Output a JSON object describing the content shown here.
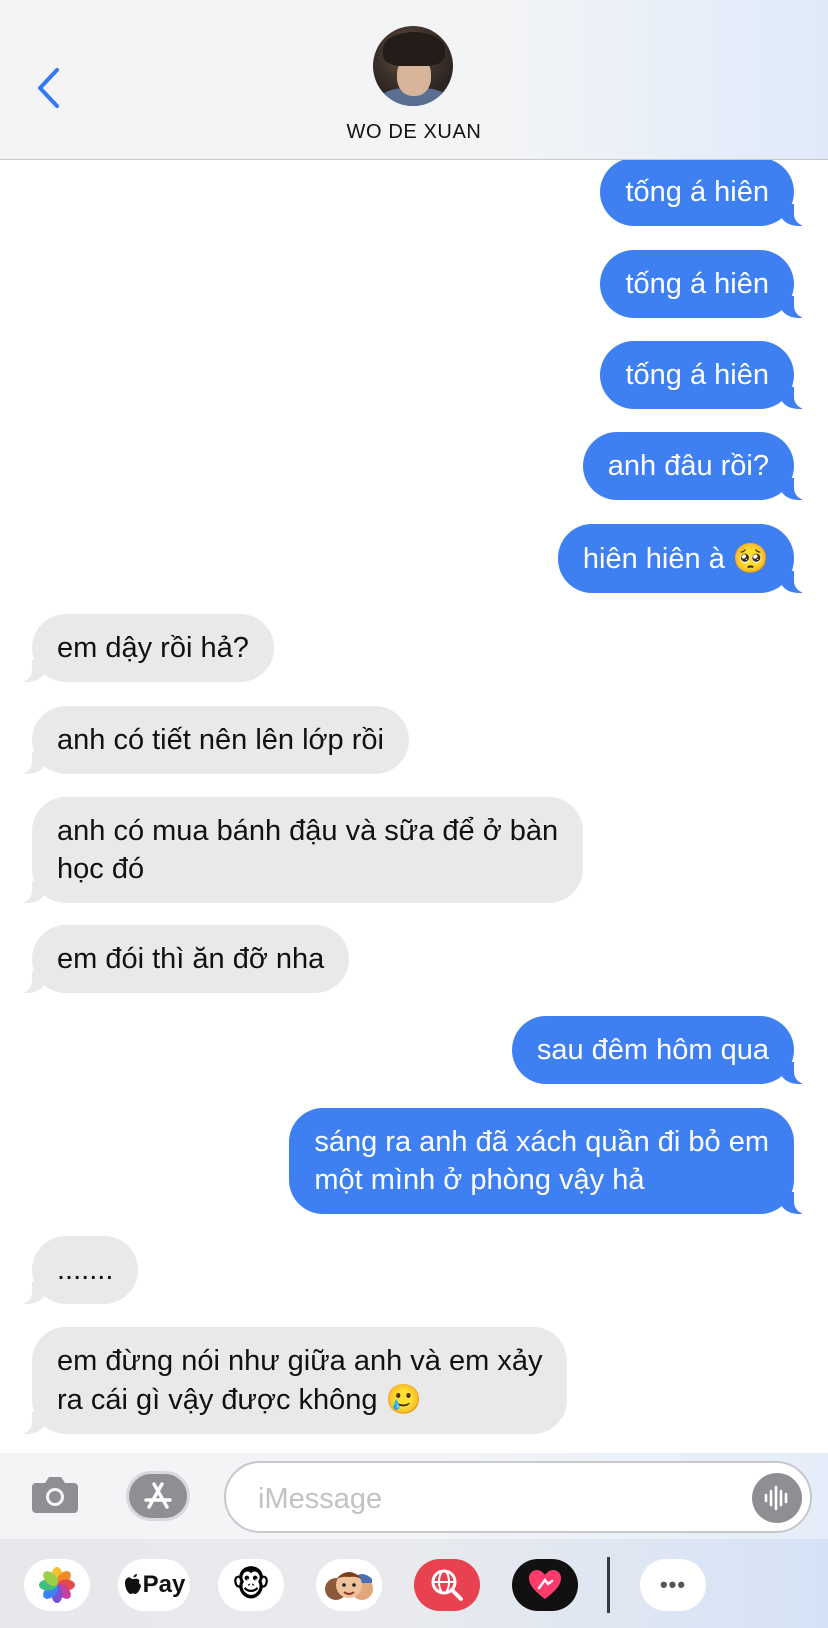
{
  "header": {
    "contact_name": "WO DE XUAN",
    "back_icon": "chevron-left-icon",
    "accent_color": "#3478F6"
  },
  "messages": [
    {
      "dir": "out",
      "text": "tống á hiên"
    },
    {
      "dir": "out",
      "text": "tống á hiên"
    },
    {
      "dir": "out",
      "text": "tống á hiên"
    },
    {
      "dir": "out",
      "text": "anh đâu rồi?"
    },
    {
      "dir": "out",
      "text": "hiên hiên à",
      "emoji": "🥺"
    },
    {
      "dir": "in",
      "text": "em dậy rồi hả?"
    },
    {
      "dir": "in",
      "text": "anh có tiết nên lên lớp rồi"
    },
    {
      "dir": "in",
      "text": "anh có mua bánh đậu và sữa để ở bàn",
      "text2": "học đó"
    },
    {
      "dir": "in",
      "text": "em đói thì ăn đỡ nha"
    },
    {
      "dir": "out",
      "text": "sau đêm hôm qua"
    },
    {
      "dir": "out",
      "text": "sáng ra anh đã xách quần đi bỏ em",
      "text2": "một mình ở phòng vậy hả"
    },
    {
      "dir": "in",
      "text": "......."
    },
    {
      "dir": "in",
      "text": "em đừng nói như giữa anh và em xảy",
      "text2": "ra cái gì vậy được không",
      "emoji": "🥲"
    }
  ],
  "composer": {
    "placeholder": "iMessage",
    "camera_icon": "camera-icon",
    "apps_icon": "app-store-icon",
    "mic_icon": "audio-waveform-icon"
  },
  "app_drawer": {
    "items": [
      {
        "name": "photos-app",
        "icon": "photos-icon"
      },
      {
        "name": "apple-pay-app",
        "label": "Pay",
        "icon": "apple-icon"
      },
      {
        "name": "animoji-app",
        "icon": "monkey-icon",
        "emoji": "🐵"
      },
      {
        "name": "memoji-app",
        "icon": "memoji-icon"
      },
      {
        "name": "web-search-app",
        "icon": "globe-search-icon"
      },
      {
        "name": "digital-touch-app",
        "icon": "heart-touch-icon"
      },
      {
        "name": "more-apps",
        "label": "•••",
        "icon": "more-icon"
      }
    ]
  },
  "colors": {
    "outgoing_bubble": "#3E80F1",
    "incoming_bubble": "#E9E9EB",
    "header_bg": "#F4F4F6"
  }
}
